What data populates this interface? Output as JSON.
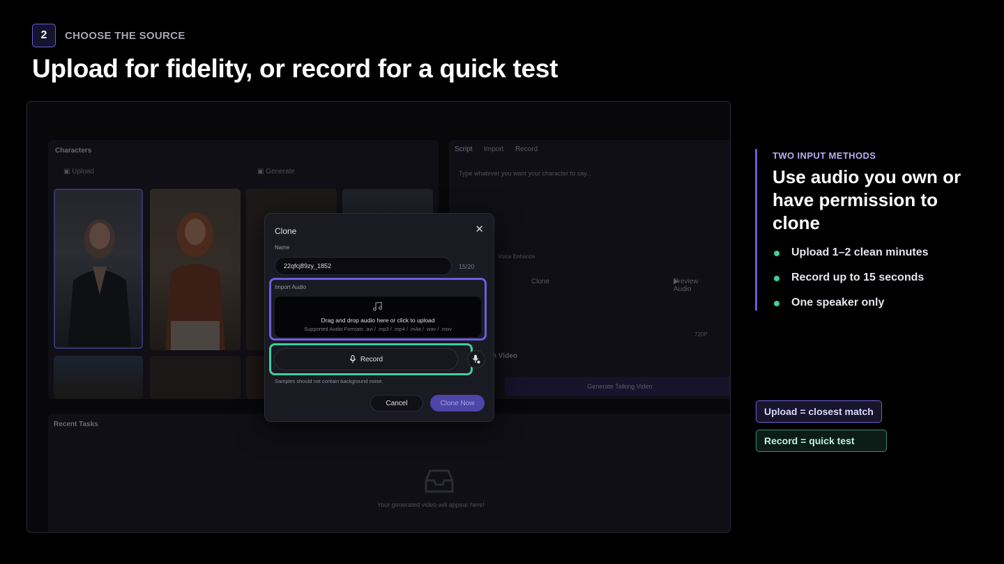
{
  "header": {
    "step_number": "2",
    "step_label": "CHOOSE THE SOURCE",
    "title": "Upload for fidelity, or record for a quick test"
  },
  "background_app": {
    "characters_title": "Characters",
    "upload_tab": "Upload",
    "generate_tab": "Generate",
    "script_tabs": [
      "Script",
      "Import",
      "Record"
    ],
    "script_placeholder": "Type whatever you want your character to say...",
    "voice_enhance": "Voice Enhance",
    "clone_chip": "Clone",
    "preview_audio": "Preview Audio",
    "resolution": "720P",
    "video_label": "n Video",
    "generate_button": "Generate Talking Video",
    "recent_tasks_title": "Recent Tasks",
    "empty_state": "Your generated video will appear here!"
  },
  "modal": {
    "title": "Clone",
    "name_label": "Name",
    "name_value": "22qfcj89zy_1852",
    "name_counter": "15/20",
    "import_label": "Import Audio",
    "drop_text": "Drag and drop audio here or click to upload",
    "formats": "Supported Audio Formats .avi / .mp3 / .mp4 / .m4a / .wav / .mov",
    "record_label": "Record",
    "hint": "Samples should not contain background noise.",
    "cancel_label": "Cancel",
    "clone_label": "Clone Now"
  },
  "callout": {
    "eyebrow": "TWO INPUT METHODS",
    "title": "Use audio you own or have permission to clone",
    "bullets": [
      "Upload 1–2 clean minutes",
      "Record up to 15 seconds",
      "One speaker only"
    ]
  },
  "tags": {
    "upload": "Upload = closest match",
    "record": "Record = quick test"
  },
  "colors": {
    "accent_purple": "#6c5de0",
    "accent_green": "#3ecfa0",
    "background": "#000000"
  }
}
